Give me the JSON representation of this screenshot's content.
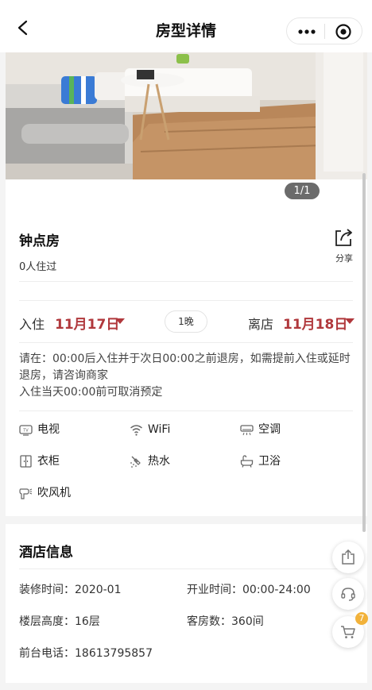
{
  "header": {
    "title": "房型详情"
  },
  "gallery": {
    "counter": "1/1"
  },
  "room": {
    "name": "钟点房",
    "stay_count": "0人住过",
    "share_label": "分享"
  },
  "booking": {
    "checkin_label": "入住",
    "checkin_date": "11月17日",
    "nights": "1晚",
    "checkout_label": "离店",
    "checkout_date": "11月18日"
  },
  "policy": {
    "line1": "请在：00:00后入住并于次日00:00之前退房，如需提前入住或延时退房，请咨询商家",
    "line2": "入住当天00:00前可取消预定"
  },
  "amenities": [
    {
      "label": "电视",
      "icon": "tv-icon"
    },
    {
      "label": "WiFi",
      "icon": "wifi-icon"
    },
    {
      "label": "空调",
      "icon": "air-conditioner-icon"
    },
    {
      "label": "衣柜",
      "icon": "wardrobe-icon"
    },
    {
      "label": "热水",
      "icon": "shower-icon"
    },
    {
      "label": "卫浴",
      "icon": "bathtub-icon"
    },
    {
      "label": "吹风机",
      "icon": "hair-dryer-icon"
    }
  ],
  "hotel": {
    "title": "酒店信息",
    "renovation": "装修时间：2020-01",
    "opening_hours": "开业时间：00:00-24:00",
    "floors": "楼层高度：16层",
    "rooms": "客房数：360间",
    "phone": "前台电话：18613795857"
  },
  "floating": {
    "cart_badge": "7"
  },
  "colors": {
    "accent": "#b0383c",
    "badge": "#f2b23a"
  }
}
